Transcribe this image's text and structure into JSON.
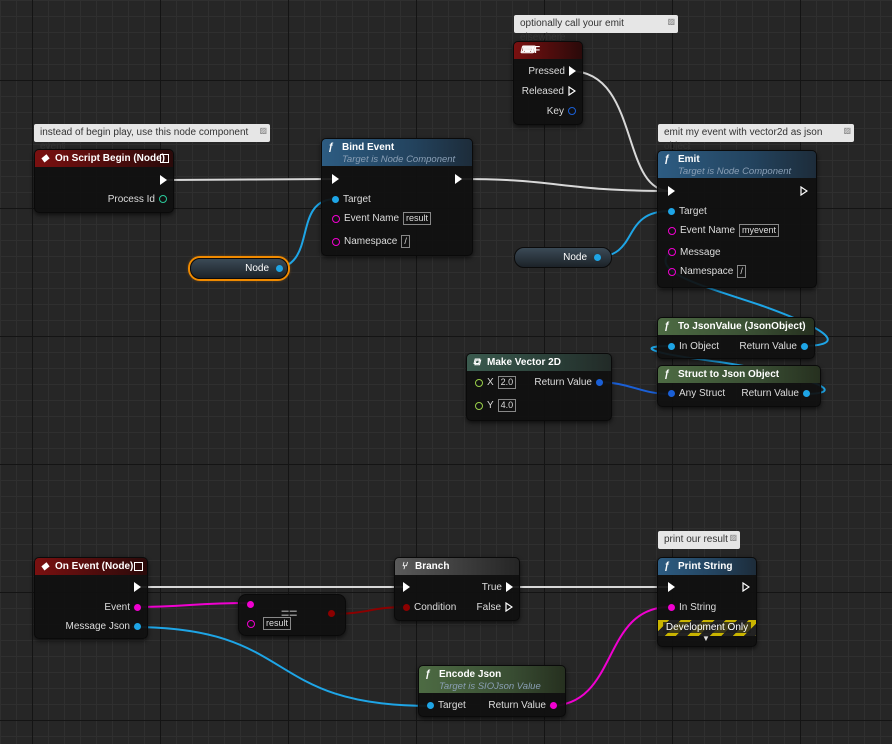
{
  "comments": {
    "begin": "instead of begin play, use this node component event",
    "f_key": "optionally call your emit elsewhere",
    "emit": "emit my event with vector2d as json object",
    "print": "print our result"
  },
  "on_script_begin": {
    "title": "On Script Begin (Node)",
    "process_id": "Process Id"
  },
  "bind_event": {
    "title": "Bind Event",
    "subtitle": "Target is Node Component",
    "target": "Target",
    "event_name_label": "Event Name",
    "event_name_value": "result",
    "namespace_label": "Namespace",
    "namespace_value": "/"
  },
  "node_var_1": {
    "label": "Node"
  },
  "node_var_2": {
    "label": "Node"
  },
  "f_key": {
    "title": "F",
    "pressed": "Pressed",
    "released": "Released",
    "key": "Key"
  },
  "emit": {
    "title": "Emit",
    "subtitle": "Target is Node Component",
    "target": "Target",
    "event_name_label": "Event Name",
    "event_name_value": "myevent",
    "message": "Message",
    "namespace_label": "Namespace",
    "namespace_value": "/"
  },
  "to_json_value": {
    "title": "To JsonValue (JsonObject)",
    "in_object": "In Object",
    "return_value": "Return Value"
  },
  "struct_to_json": {
    "title": "Struct to Json Object",
    "any_struct": "Any Struct",
    "return_value": "Return Value"
  },
  "make_vector": {
    "title": "Make Vector 2D",
    "x_label": "X",
    "x_value": "2.0",
    "y_label": "Y",
    "y_value": "4.0",
    "return_value": "Return Value"
  },
  "on_event": {
    "title": "On Event (Node)",
    "event": "Event",
    "message_json": "Message Json"
  },
  "equals": {
    "value": "result"
  },
  "branch": {
    "title": "Branch",
    "condition": "Condition",
    "true_label": "True",
    "false_label": "False"
  },
  "print_string": {
    "title": "Print String",
    "in_string": "In String",
    "dev_only": "Development Only"
  },
  "encode_json": {
    "title": "Encode Json",
    "subtitle": "Target is SIOJson Value",
    "target": "Target",
    "return_value": "Return Value"
  },
  "colors": {
    "exec": "#ffffff",
    "object": "#1ea5e6",
    "string": "#f000d0",
    "bool": "#8c0000",
    "struct": "#1a5fd6",
    "float": "#9ad04a"
  }
}
